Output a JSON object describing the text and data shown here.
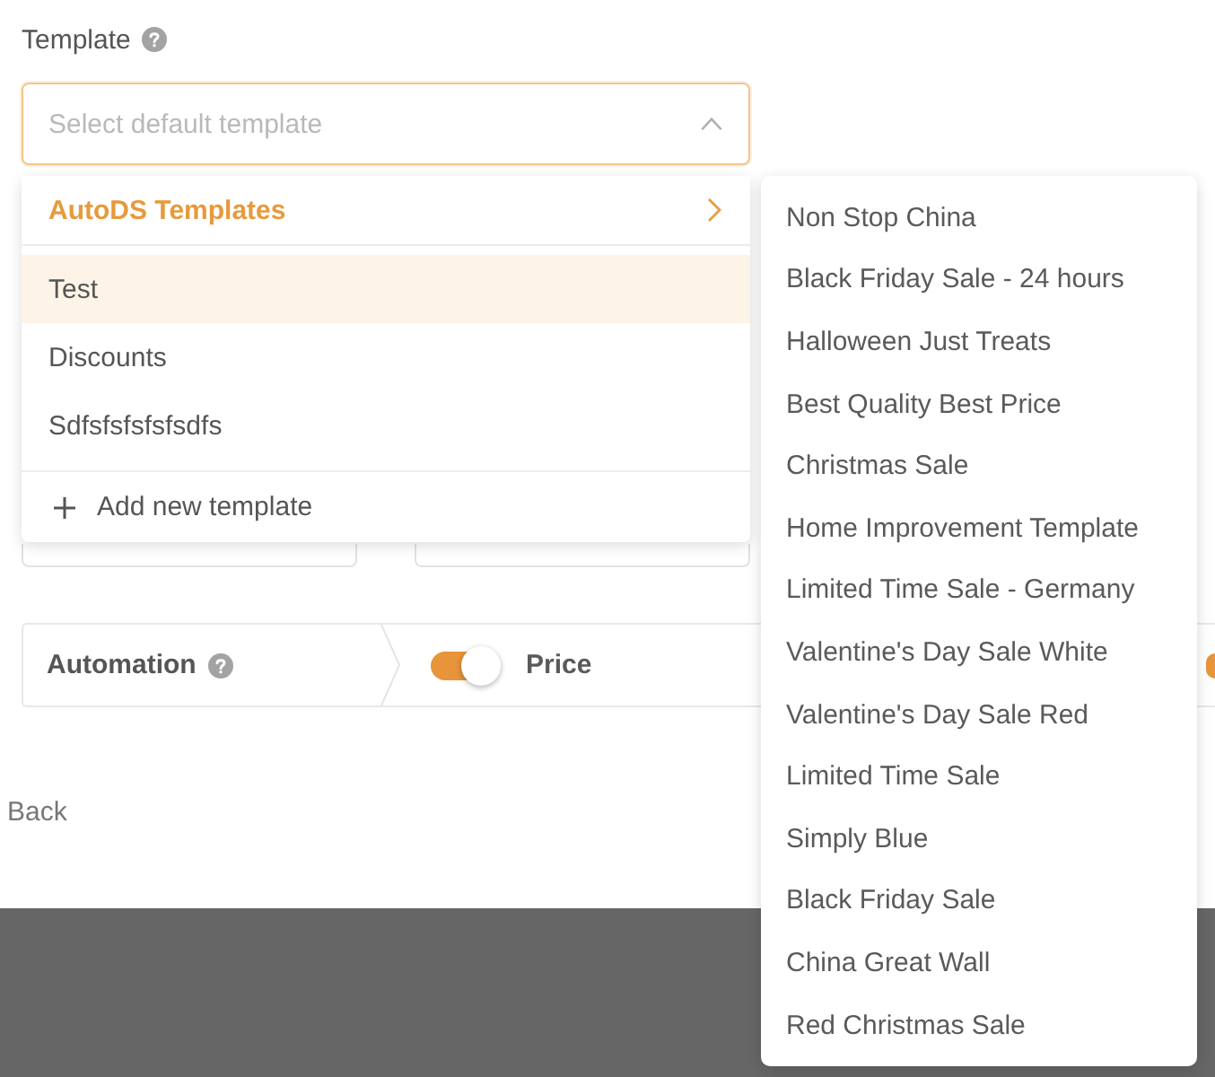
{
  "template_field": {
    "label": "Template",
    "placeholder": "Select default template",
    "expanded": true
  },
  "dropdown": {
    "group": {
      "label": "AutoDS Templates",
      "expanded": true
    },
    "items": [
      {
        "label": "Test",
        "highlighted": true
      },
      {
        "label": "Discounts",
        "highlighted": false
      },
      {
        "label": "Sdfsfsfsfsfsdfs",
        "highlighted": false
      }
    ],
    "add_action": {
      "label": "Add new template"
    }
  },
  "submenu": {
    "items": [
      "Non Stop China",
      "Black Friday Sale - 24 hours",
      "Halloween Just Treats",
      "Best Quality Best Price",
      "Christmas Sale",
      "Home Improvement Template",
      "Limited Time Sale - Germany",
      "Valentine's Day Sale White",
      "Valentine's Day Sale Red",
      "Limited Time Sale",
      "Simply Blue",
      "Black Friday Sale",
      "China Great Wall",
      "Red Christmas Sale"
    ]
  },
  "automation": {
    "label": "Automation",
    "toggles": [
      {
        "label": "Price",
        "on": true
      },
      {
        "on": true
      }
    ]
  },
  "back_link": {
    "label": "Back"
  }
}
